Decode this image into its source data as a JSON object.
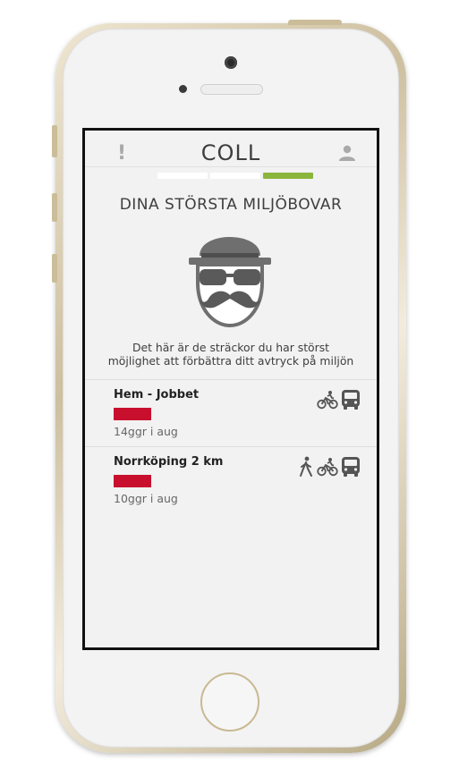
{
  "app": {
    "title": "COLL",
    "alert_icon": "exclamation-icon",
    "profile_icon": "user-icon"
  },
  "progress": {
    "segments": [
      {
        "state": "inactive",
        "color": "#ffffff"
      },
      {
        "state": "inactive",
        "color": "#ffffff"
      },
      {
        "state": "active",
        "color": "#8cb53e"
      }
    ],
    "current_step": 3,
    "total_steps": 3
  },
  "main": {
    "heading": "DINA STÖRSTA MILJÖBOVAR",
    "mascot_icon": "mustache-man-icon",
    "description_line1": "Det här är de sträckor du har störst",
    "description_line2": "möjlighet att förbättra ditt avtryck på miljön"
  },
  "routes": [
    {
      "name": "Hem - Jobbet",
      "frequency": "14ggr i aug",
      "bar_color": "#c8102e",
      "modes": [
        "bicycle-icon",
        "bus-icon"
      ]
    },
    {
      "name": "Norrköping 2 km",
      "frequency": "10ggr i aug",
      "bar_color": "#c8102e",
      "modes": [
        "walking-icon",
        "bicycle-icon",
        "bus-icon"
      ]
    }
  ],
  "colors": {
    "accent": "#8cb53e",
    "warning": "#c8102e",
    "text": "#3e3e3e",
    "icon": "#555555"
  }
}
